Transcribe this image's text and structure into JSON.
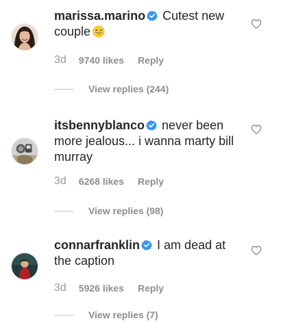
{
  "comments": [
    {
      "username": "marissa.marino",
      "text": "Cutest new couple",
      "emoji": "grinning-sweat-emoji",
      "time": "3d",
      "likes": "9740 likes",
      "reply_label": "Reply",
      "view_replies": "View replies (244)"
    },
    {
      "username": "itsbennyblanco",
      "text": "never been more jealous... i wanna marty bill murray",
      "time": "3d",
      "likes": "6268 likes",
      "reply_label": "Reply",
      "view_replies": "View replies (98)"
    },
    {
      "username": "connarfranklin",
      "text": "I am dead at the caption",
      "time": "3d",
      "likes": "5926 likes",
      "reply_label": "Reply",
      "view_replies": "View replies (7)"
    }
  ],
  "icons": {
    "verified": "verified-badge-icon",
    "like": "heart-outline-icon"
  },
  "colors": {
    "verified_blue": "#3897f0",
    "meta_gray": "#8e8e8e",
    "text": "#262626"
  }
}
